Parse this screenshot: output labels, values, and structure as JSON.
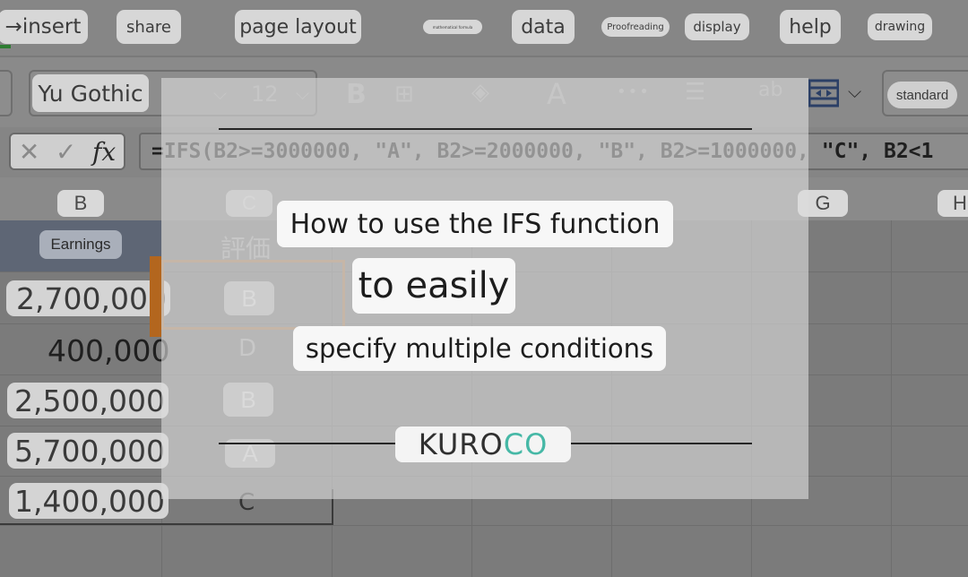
{
  "ribbon": {
    "tabs": [
      {
        "label": "→insert"
      },
      {
        "label": "share"
      },
      {
        "label": "page layout"
      },
      {
        "label": "mathematical formula"
      },
      {
        "label": "data"
      },
      {
        "label": "Proofreading"
      },
      {
        "label": "display"
      },
      {
        "label": "help"
      },
      {
        "label": "drawing"
      }
    ]
  },
  "toolbar": {
    "font_name": "Yu Gothic",
    "font_size": "12",
    "bold_label": "B",
    "font_color_label": "A",
    "more_label": "•••",
    "number_format": "standard"
  },
  "formula_bar": {
    "cancel_label": "✕",
    "confirm_label": "✓",
    "fx_label": "fx",
    "formula": "=IFS(B2>=3000000, \"A\", B2>=2000000, \"B\", B2>=1000000, \"C\", B2<1"
  },
  "columns": [
    {
      "label": "B"
    },
    {
      "label": "C"
    },
    {
      "label": "G"
    },
    {
      "label": "H"
    }
  ],
  "sheet": {
    "header_b": "Earnings",
    "header_c": "評価",
    "rows": [
      {
        "earnings": "2,700,000",
        "grade": "B"
      },
      {
        "earnings": "400,000",
        "grade": "D"
      },
      {
        "earnings": "2,500,000",
        "grade": "B"
      },
      {
        "earnings": "5,700,000",
        "grade": "A"
      },
      {
        "earnings": "1,400,000",
        "grade": "C"
      }
    ]
  },
  "overlay": {
    "line1": "How to use the IFS function",
    "line2": "to easily",
    "line3": "specify multiple conditions",
    "logo_kuro": "KURO",
    "logo_co": "CO"
  },
  "colors": {
    "accent_orange": "#b3661e",
    "logo_teal": "#46b8a6",
    "header_band": "#5e6675"
  }
}
